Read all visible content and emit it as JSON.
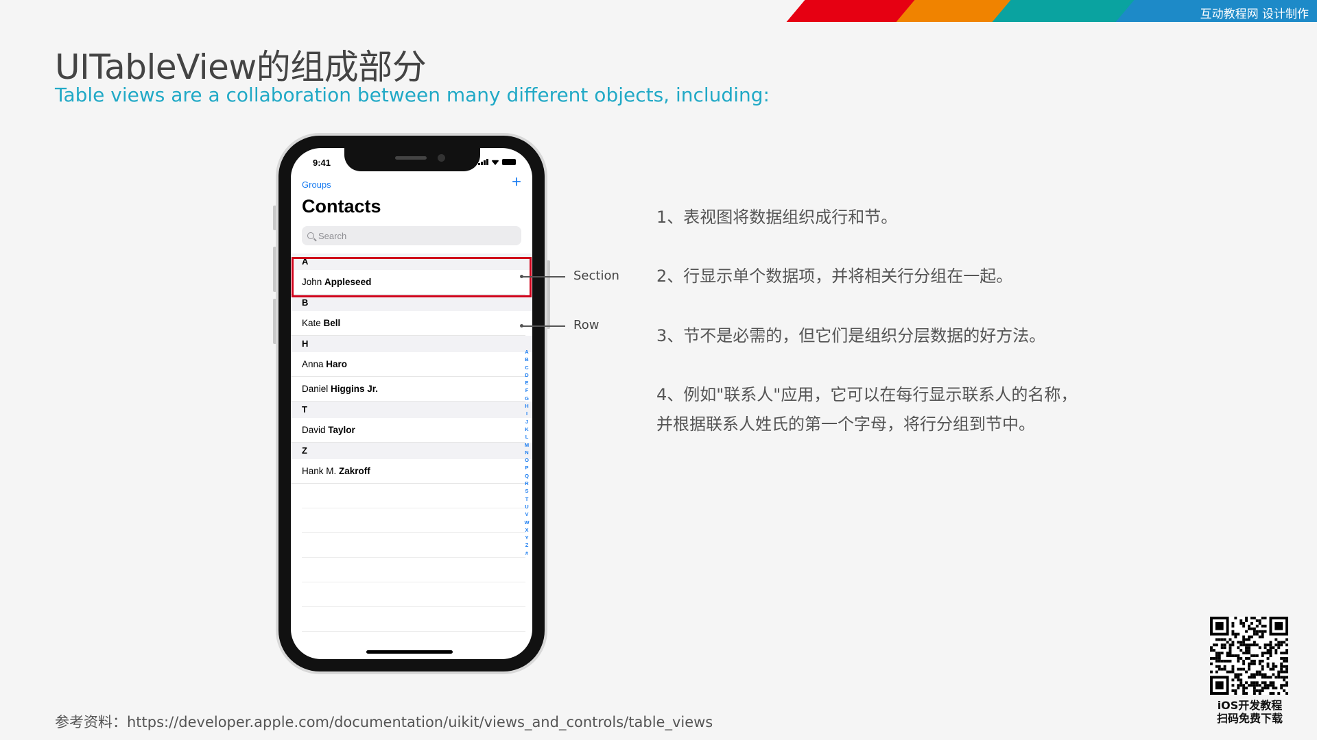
{
  "banner": {
    "text": "互动教程网 设计制作"
  },
  "title": "UITableView的组成部分",
  "subtitle": "Table views are a collaboration between many different objects, including:",
  "reference": "参考资料：https://developer.apple.com/documentation/uikit/views_and_controls/table_views",
  "phone": {
    "time": "9:41",
    "nav_back": "Groups",
    "nav_add": "+",
    "large_title": "Contacts",
    "search_placeholder": "Search",
    "sections": [
      {
        "header": "A",
        "rows": [
          {
            "first": "John",
            "last": "Appleseed"
          }
        ]
      },
      {
        "header": "B",
        "rows": [
          {
            "first": "Kate",
            "last": "Bell"
          }
        ]
      },
      {
        "header": "H",
        "rows": [
          {
            "first": "Anna",
            "last": "Haro"
          },
          {
            "first": "Daniel",
            "last": "Higgins Jr."
          }
        ]
      },
      {
        "header": "T",
        "rows": [
          {
            "first": "David",
            "last": "Taylor"
          }
        ]
      },
      {
        "header": "Z",
        "rows": [
          {
            "first": "Hank M.",
            "last": "Zakroff"
          }
        ]
      }
    ],
    "index_letters": "A B C D E F G H I J K L M N O P Q R S T U V W X Y Z #"
  },
  "callouts": {
    "section": "Section",
    "row": "Row"
  },
  "descriptions": [
    "1、表视图将数据组织成行和节。",
    "2、行显示单个数据项，并将相关行分组在一起。",
    "3、节不是必需的，但它们是组织分层数据的好方法。",
    "4、例如\"联系人\"应用，它可以在每行显示联系人的名称，",
    "并根据联系人姓氏的第一个字母，将行分组到节中。"
  ],
  "qr_caption": {
    "line1": "iOS开发教程",
    "line2": "扫码免费下载"
  },
  "colors": {
    "accent": "#21a9c6",
    "ios_blue": "#1a7cf0",
    "highlight_red": "#d0021b"
  }
}
